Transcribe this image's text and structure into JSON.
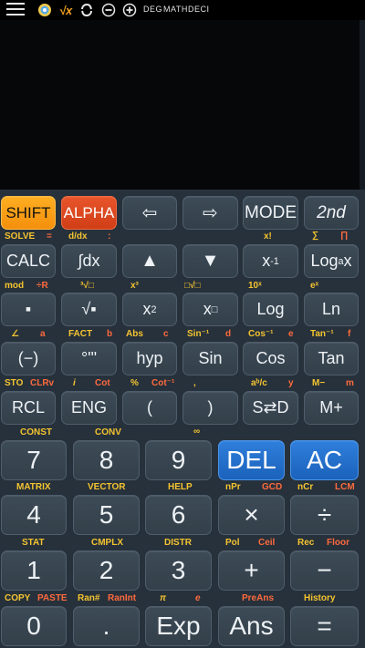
{
  "status_bar": {
    "mode_deg": "DEG",
    "mode_math": "MATH",
    "mode_deci": "DECI",
    "icons": [
      "menu-icon",
      "palette-icon",
      "sqrt-x-icon",
      "convert-icon",
      "minus-circle-icon",
      "plus-circle-icon"
    ],
    "sqrt_label": "√x"
  },
  "colors": {
    "background": "#27313b",
    "key": "#37444f",
    "shift": "#f7981b",
    "alpha": "#db4a22",
    "blue": "#2570cc",
    "label_yellow": "#f4c430",
    "label_red": "#ff6a3d",
    "display": "#050709"
  },
  "rows": {
    "r1": {
      "shift": "SHIFT",
      "alpha": "ALPHA",
      "left": "⇦",
      "right": "⇨",
      "mode": "MODE",
      "second": "2nd"
    },
    "r1_sub": {
      "solve": "SOLVE",
      "eq": "=",
      "ddx": "d/dx",
      "colon": ":",
      "xfact": "x!",
      "sigma": "∑",
      "pi": "∏"
    },
    "r2": {
      "calc": "CALC",
      "integ": "∫dx",
      "up": "▲",
      "down": "▼",
      "xinv_base": "x",
      "xinv_sup": "-1",
      "log_base": "Log",
      "log_sub": "a",
      "log_x": "x"
    },
    "r2_sub": {
      "mod": "mod",
      "r": "÷R",
      "x3": "x³",
      "cbrt": "³√□",
      "xroot": "□√□",
      "tenx": "10ˣ",
      "ex": "eˣ"
    },
    "r3": {
      "frac": "▪",
      "sqrt": "√▪",
      "x2_base": "x",
      "x2_sup": "2",
      "xpow_base": "x",
      "xpow_sup": "□",
      "log": "Log",
      "ln": "Ln"
    },
    "r3_sub": {
      "angle": "∠",
      "a": "a",
      "fact": "FACT",
      "b": "b",
      "abs": "Abs",
      "c": "c",
      "asin": "Sin⁻¹",
      "d": "d",
      "acos": "Cos⁻¹",
      "e": "e",
      "atan": "Tan⁻¹",
      "f": "f"
    },
    "r4": {
      "neg": "(−)",
      "dms": "°'\"",
      "hyp": "hyp",
      "sin": "Sin",
      "cos": "Cos",
      "tan": "Tan"
    },
    "r4_sub": {
      "sto": "STO",
      "clrv": "CLRv",
      "i": "i",
      "cot": "Cot",
      "pct": "%",
      "acot": "Cot⁻¹",
      "comma": ",",
      "abc": "aᵇ/c",
      "yy": "y",
      "mminus": "M−",
      "m": "m"
    },
    "r5": {
      "rcl": "RCL",
      "eng": "ENG",
      "lparen": "(",
      "rparen": ")",
      "sd": "S⇄D",
      "mplus": "M+"
    },
    "r5_sub": {
      "const": "CONST",
      "conv": "CONV",
      "inf": "∞"
    },
    "r6": {
      "seven": "7",
      "eight": "8",
      "nine": "9",
      "del": "DEL",
      "ac": "AC"
    },
    "r6_sub": {
      "matrix": "MATRIX",
      "vector": "VECTOR",
      "help": "HELP",
      "npr": "nPr",
      "gcd": "GCD",
      "ncr": "nCr",
      "lcm": "LCM"
    },
    "r7": {
      "four": "4",
      "five": "5",
      "six": "6",
      "mul": "×",
      "div": "÷"
    },
    "r7_sub": {
      "stat": "STAT",
      "cmplx": "CMPLX",
      "distr": "DISTR",
      "pol": "Pol",
      "ceil": "Ceil",
      "rec": "Rec",
      "floor": "Floor"
    },
    "r8": {
      "one": "1",
      "two": "2",
      "three": "3",
      "plus": "+",
      "minus": "−"
    },
    "r8_sub": {
      "copy": "COPY",
      "paste": "PASTE",
      "ranhash": "Ran#",
      "ranint": "RanInt",
      "pi": "π",
      "e": "e",
      "preans": "PreAns",
      "history": "History"
    },
    "r9": {
      "zero": "0",
      "dot": ".",
      "exp": "Exp",
      "ans": "Ans",
      "eq": "="
    }
  }
}
